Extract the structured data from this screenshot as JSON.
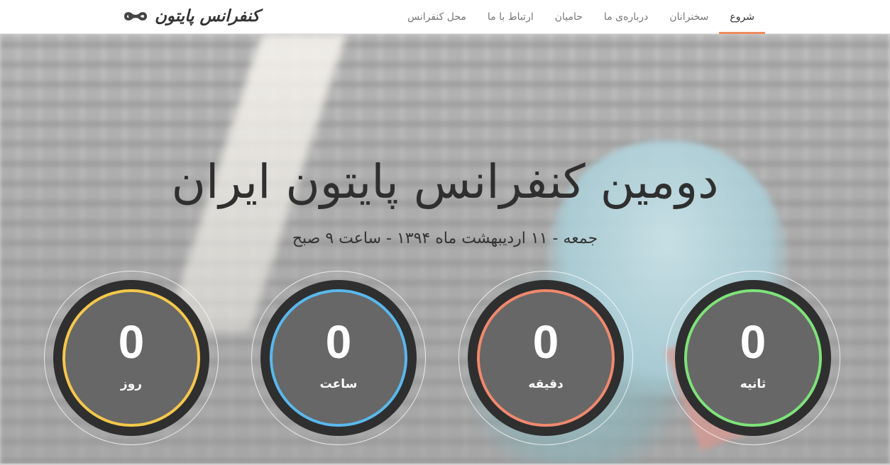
{
  "brand": {
    "name": "کنفرانس پایتون",
    "icon": "infinity-icon"
  },
  "nav": {
    "items": [
      {
        "label": "شروع",
        "active": true
      },
      {
        "label": "سخنرانان",
        "active": false
      },
      {
        "label": "درباره‌ی ما",
        "active": false
      },
      {
        "label": "حامیان",
        "active": false
      },
      {
        "label": "ارتباط با ما",
        "active": false
      },
      {
        "label": "محل کنفرانس",
        "active": false
      }
    ],
    "active_color": "#f08a5d"
  },
  "hero": {
    "title": "دومین کنفرانس پایتون ایران",
    "subtitle": "جمعه - ۱۱ اردیبهشت ماه ۱۳۹۴ - ساعت ۹ صبح"
  },
  "countdown": [
    {
      "value": "0",
      "label": "روز",
      "color": "#f5c84c"
    },
    {
      "value": "0",
      "label": "ساعت",
      "color": "#5bb8ec"
    },
    {
      "value": "0",
      "label": "دقیقه",
      "color": "#f08a6e"
    },
    {
      "value": "0",
      "label": "ثانیه",
      "color": "#7fe37a"
    }
  ]
}
